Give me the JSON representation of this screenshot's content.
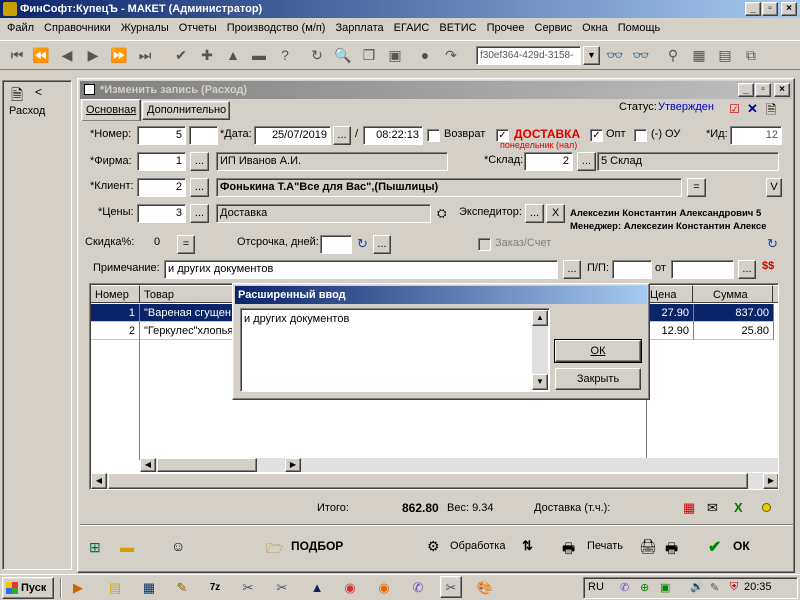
{
  "app": {
    "title": "ФинСофт:КупецЪ - МАКЕТ  (Администратор)"
  },
  "menu": [
    "Файл",
    "Справочники",
    "Журналы",
    "Отчеты",
    "Производство (м/п)",
    "Зарплата",
    "ЕГАИС",
    "ВЕТИС",
    "Прочее",
    "Сервис",
    "Окна",
    "Помощь"
  ],
  "toolbar": {
    "guid": "f30ef364-429d-3158-"
  },
  "side": {
    "label": "Расход",
    "back": "<"
  },
  "doc": {
    "title": "*Изменить запись (Расход)",
    "tabs": [
      "Основная",
      "Дополнительно"
    ],
    "status_label": "Статус:",
    "status_value": "Утвержден",
    "number_label": "*Номер:",
    "number": "5",
    "date_label": "*Дата:",
    "date": "25/07/2019",
    "date_btn": "...",
    "slash": "/",
    "time": "08:22:13",
    "return_label": "Возврат",
    "delivery_label": "ДОСТАВКА",
    "delivery_day": "понедельник (нал)",
    "delivery_check": "✓",
    "opt_label": "Опт",
    "opt_check": "✓",
    "ou_label": "(-) ОУ",
    "id_label": "*Ид:",
    "id": "12",
    "firm_label": "*Фирма:",
    "firm_code": "1",
    "firm_name": "ИП Иванов А.И.",
    "warehouse_label": "*Склад:",
    "warehouse_code": "2",
    "warehouse_name": "5 Склад",
    "client_label": "*Клиент:",
    "client_code": "2",
    "client_name": "Фонькина Т.А\"Все для Вас\",(Пышлицы)",
    "eq_btn": "=",
    "v_btn": "V",
    "price_label": "*Цены:",
    "price_code": "3",
    "price_name": "Доставка",
    "forwarder_label": "Экспедитор:",
    "forwarder_x": "X",
    "forwarder_name": "Алексеzин Константин Александрович  5",
    "manager": "Менеджер: Алексеzин Константин Алексе",
    "discount_label": "Скидка%:",
    "discount": "0",
    "delay_label": "Отсрочка, дней:",
    "order_label": "Заказ/Счет",
    "note_label": "Примечание:",
    "note": "и других документов",
    "pp_label": "П/П:",
    "from_label": "от",
    "grid_headers": {
      "num": "Номер",
      "item": "Товар",
      "price": "Цена",
      "sum": "Сумма"
    },
    "rows": [
      {
        "num": "1",
        "item": "\"Вареная сгущен",
        "price": "27.90",
        "sum": "837.00"
      },
      {
        "num": "2",
        "item": "\"Геркулес\"хлопья",
        "price": "12.90",
        "sum": "25.80"
      }
    ],
    "total_label": "Итого:",
    "total": "862.80",
    "weight": "Вес: 9.34",
    "delivery_tc": "Доставка (т.ч.):",
    "podbor": "ПОДБОР",
    "processing": "Обработка",
    "print": "Печать",
    "ok": "ОК"
  },
  "dialog": {
    "title": "Расширенный ввод",
    "text": "и других документов",
    "ok": "ОК",
    "close": "Закрыть"
  },
  "taskbar": {
    "start": "Пуск",
    "lang": "RU",
    "clock": "20:35"
  }
}
